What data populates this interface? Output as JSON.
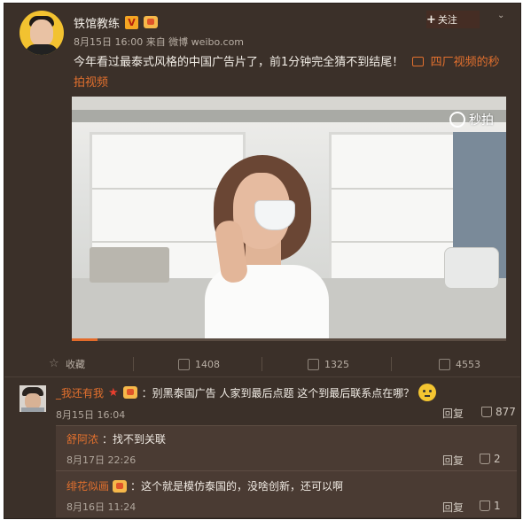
{
  "post": {
    "author": "铁馆教练",
    "meta": "8月15日 16:00 来自 微博 weibo.com",
    "text": "今年看过最泰式风格的中国广告片了，前1分钟完全猜不到结尾！",
    "link_text": "四厂视频的秒拍视频",
    "follow_label": "关注",
    "video_watermark": "秒拍",
    "video_progress": 0.06
  },
  "actions": {
    "favorite": "收藏",
    "repost": "1408",
    "comments": "1325",
    "likes": "4553"
  },
  "comment": {
    "user": "_我还有我",
    "text": "：别黑泰国广告 人家到最后点题 这个到最后联系点在哪？",
    "time": "8月15日 16:04",
    "reply_label": "回复",
    "likes": "877"
  },
  "replies": [
    {
      "user": "舒阿浓",
      "text": "：找不到关联",
      "time": "8月17日 22:26",
      "reply_label": "回复",
      "likes": "2"
    },
    {
      "user": "绯花似画",
      "text": "：这个就是模仿泰国的，没啥创新，还可以啊",
      "time": "8月16日 11:24",
      "reply_label": "回复",
      "likes": "1"
    }
  ],
  "colors": {
    "background": "#3b3029",
    "accent_orange": "#e2702e",
    "progress": "#e36b2a"
  },
  "icons": {
    "verified": "verified-v-icon",
    "level": "member-level-icon",
    "star": "star-icon",
    "repost": "repost-icon",
    "comment": "comment-icon",
    "like": "thumbs-up-icon"
  }
}
